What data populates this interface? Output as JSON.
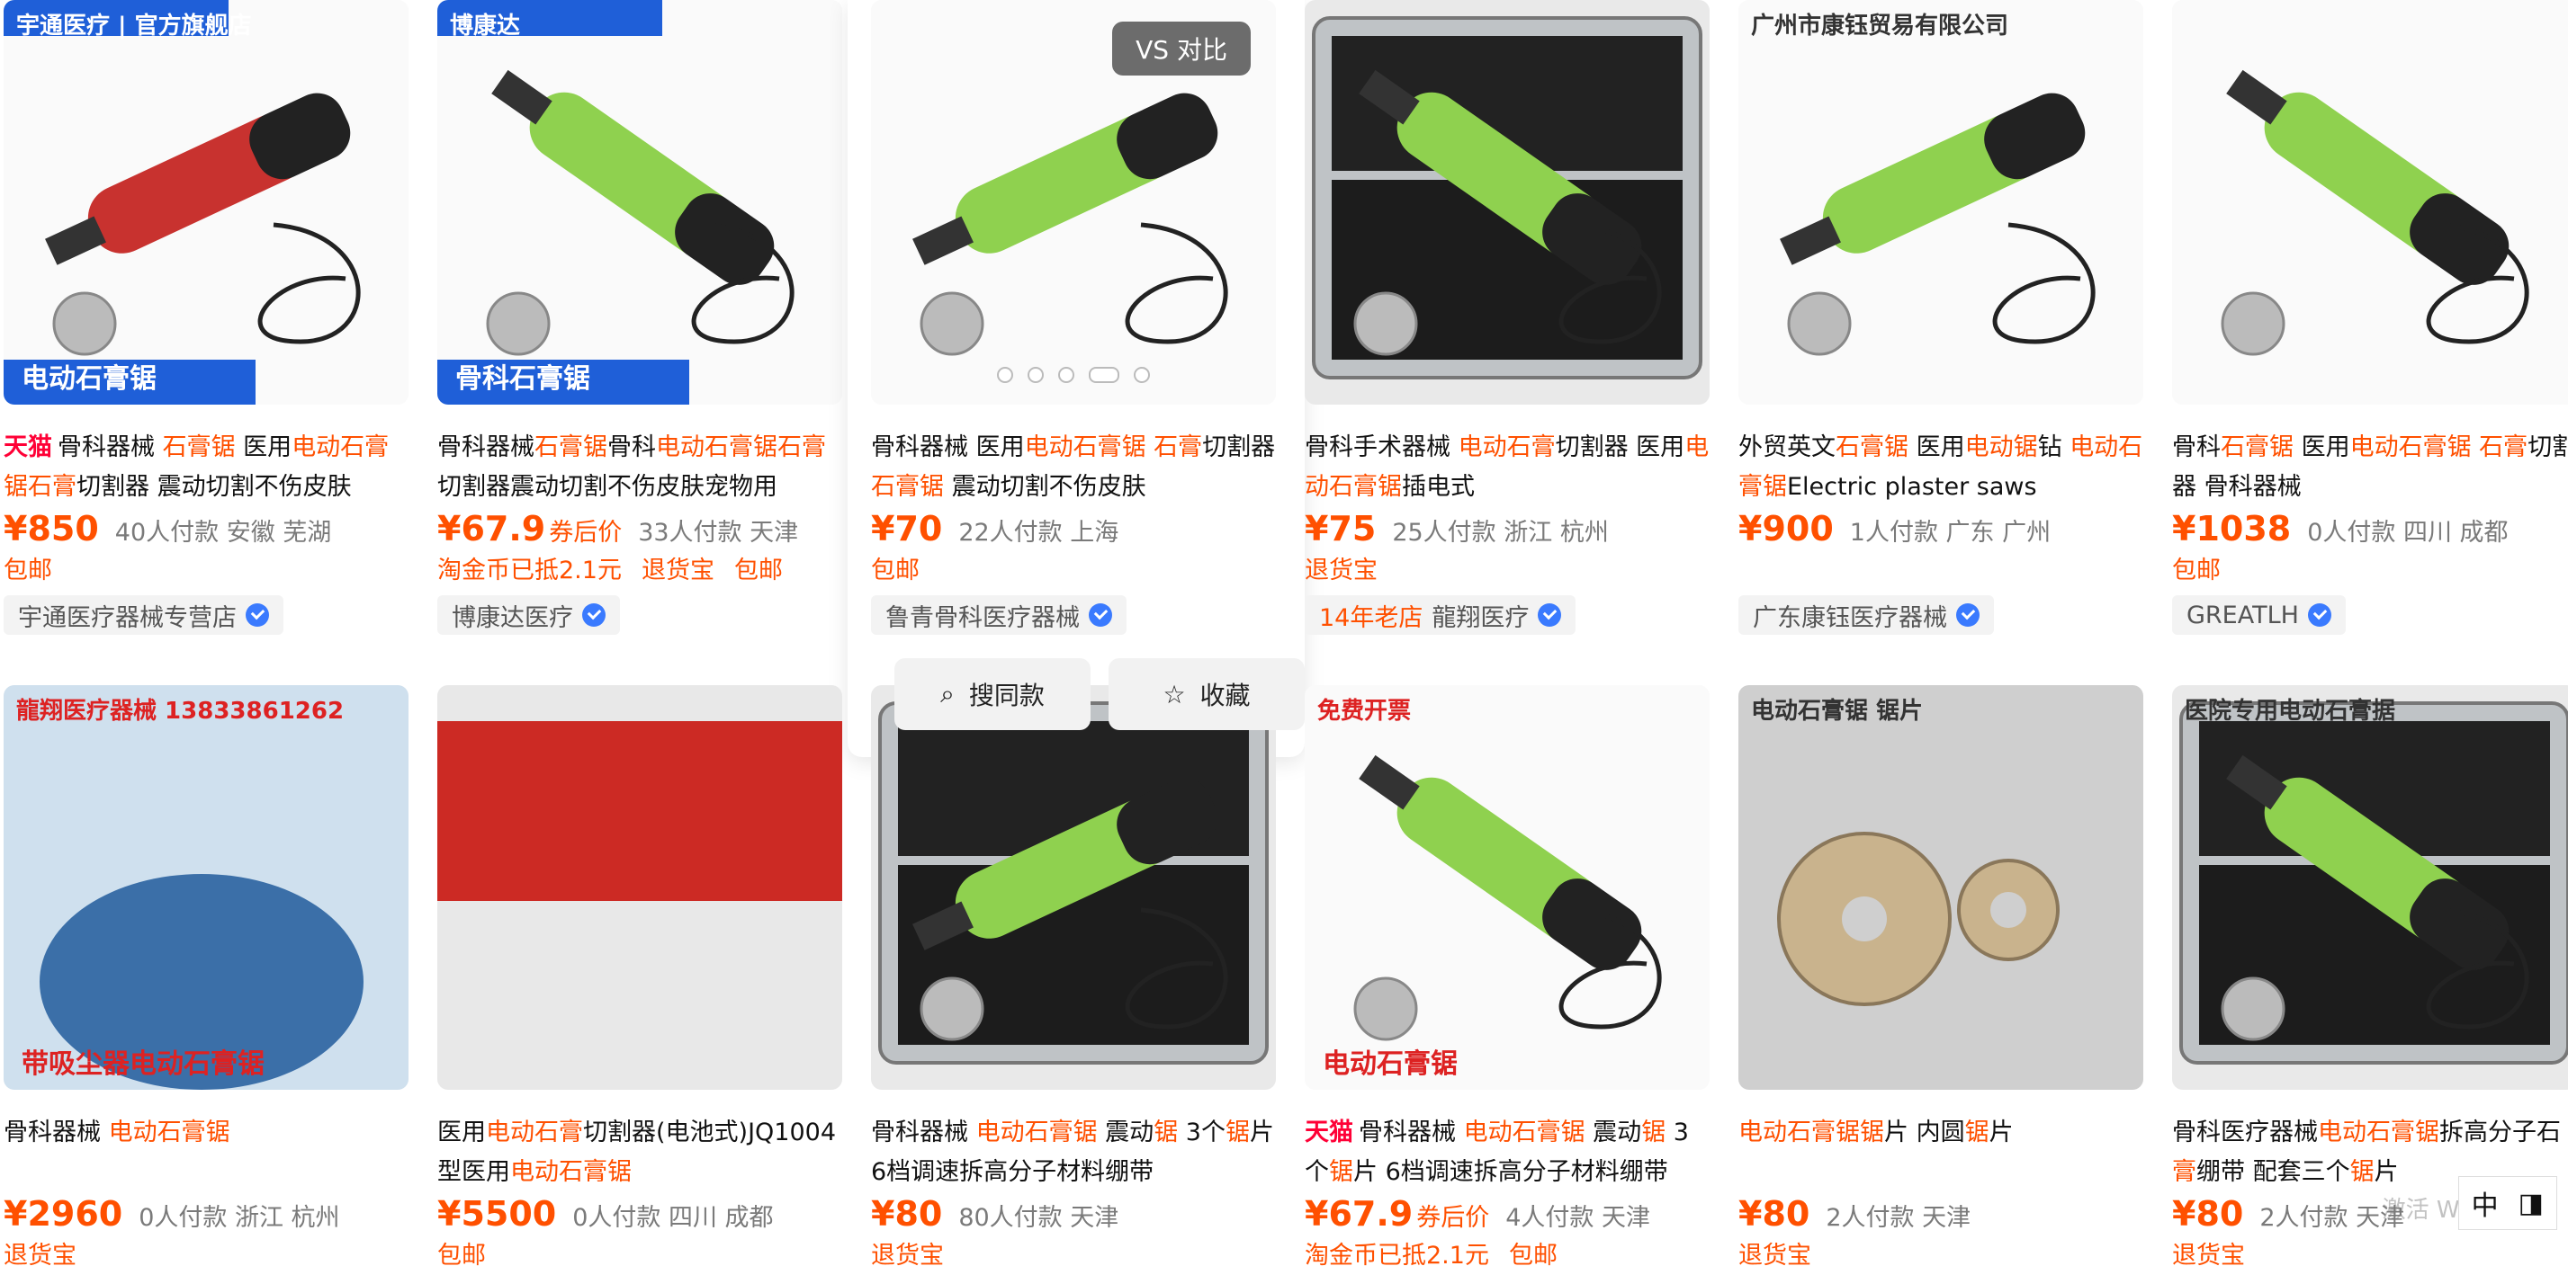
{
  "compare_button": {
    "label": "VS  对比"
  },
  "hover_actions": {
    "same_label": "搜同款",
    "fav_label": "收藏"
  },
  "ime": {
    "mode": "中"
  },
  "watermark": "激活 Windows",
  "cards": [
    {
      "img_text": "宇通医疗 | 官方旗舰店",
      "img_bottom": "电动石膏锯",
      "title_parts": [
        {
          "t": "天猫",
          "c": "tmall"
        },
        {
          "t": "骨科器械 "
        },
        {
          "t": "石膏锯",
          "c": "hl"
        },
        {
          "t": " 医用"
        },
        {
          "t": "电动石膏锯石膏",
          "c": "hl"
        },
        {
          "t": "切割器 震动切割不伤皮肤"
        }
      ],
      "price": "¥850",
      "coupon": "",
      "meta": "40人付款  安徽 芜湖",
      "tags": [
        "包邮"
      ],
      "shop": "宇通医疗器械专营店",
      "old": ""
    },
    {
      "img_text": "博康达",
      "img_bottom": "骨科石膏锯",
      "title_parts": [
        {
          "t": "骨科器械"
        },
        {
          "t": "石膏锯",
          "c": "hl"
        },
        {
          "t": "骨科"
        },
        {
          "t": "电动石膏锯石膏",
          "c": "hl"
        },
        {
          "t": "切割器震动切割不伤皮肤宠物用"
        }
      ],
      "price": "¥67.9",
      "coupon": "券后价",
      "meta": "33人付款  天津",
      "tags": [
        "淘金币已抵2.1元",
        "退货宝",
        "包邮"
      ],
      "shop": "博康达医疗",
      "old": ""
    },
    {
      "img_text": "",
      "img_bottom": "",
      "title_parts": [
        {
          "t": "骨科器械 医用"
        },
        {
          "t": "电动石膏锯 石膏",
          "c": "hl"
        },
        {
          "t": "切割器 "
        },
        {
          "t": "石膏锯",
          "c": "hl"
        },
        {
          "t": " 震动切割不伤皮肤"
        }
      ],
      "price": "¥70",
      "coupon": "",
      "meta": "22人付款  上海",
      "tags": [
        "包邮"
      ],
      "shop": "鲁青骨科医疗器械",
      "old": ""
    },
    {
      "img_text": "",
      "img_bottom": "",
      "title_parts": [
        {
          "t": "骨科手术器械 "
        },
        {
          "t": "电动石膏",
          "c": "hl"
        },
        {
          "t": "切割器 医用"
        },
        {
          "t": "电动石膏锯",
          "c": "hl"
        },
        {
          "t": "插电式"
        }
      ],
      "price": "¥75",
      "coupon": "",
      "meta": "25人付款  浙江 杭州",
      "tags": [
        "退货宝"
      ],
      "shop": "龍翔医疗",
      "old": "14年老店"
    },
    {
      "img_text": "广州市康钰贸易有限公司",
      "img_bottom": "",
      "title_parts": [
        {
          "t": "外贸英文"
        },
        {
          "t": "石膏锯",
          "c": "hl"
        },
        {
          "t": " 医用"
        },
        {
          "t": "电动锯",
          "c": "hl"
        },
        {
          "t": "钻 "
        },
        {
          "t": "电动石膏锯",
          "c": "hl"
        },
        {
          "t": "Electric plaster saws"
        }
      ],
      "price": "¥900",
      "coupon": "",
      "meta": "1人付款  广东 广州",
      "tags": [],
      "shop": "广东康钰医疗器械",
      "old": ""
    },
    {
      "img_text": "",
      "img_bottom": "",
      "title_parts": [
        {
          "t": "骨科"
        },
        {
          "t": "石膏锯",
          "c": "hl"
        },
        {
          "t": " 医用"
        },
        {
          "t": "电动石膏锯 石膏",
          "c": "hl"
        },
        {
          "t": "切割器 骨科器械"
        }
      ],
      "price": "¥1038",
      "coupon": "",
      "meta": "0人付款  四川 成都",
      "tags": [
        "包邮"
      ],
      "shop": "GREATLH",
      "old": ""
    },
    {
      "img_text": "龍翔医疗器械 13833861262",
      "img_bottom": "带吸尘器电动石膏锯",
      "title_parts": [
        {
          "t": "骨科器械 "
        },
        {
          "t": "电动石膏锯",
          "c": "hl"
        }
      ],
      "price": "¥2960",
      "coupon": "",
      "meta": "0人付款  浙江 杭州",
      "tags": [
        "退货宝"
      ],
      "shop": "",
      "old": ""
    },
    {
      "img_text": "",
      "img_bottom": "",
      "title_parts": [
        {
          "t": "医用"
        },
        {
          "t": "电动石膏",
          "c": "hl"
        },
        {
          "t": "切割器(电池式)JQ1004型医用"
        },
        {
          "t": "电动石膏锯",
          "c": "hl"
        }
      ],
      "price": "¥5500",
      "coupon": "",
      "meta": "0人付款  四川 成都",
      "tags": [
        "包邮"
      ],
      "shop": "",
      "old": ""
    },
    {
      "img_text": "",
      "img_bottom": "",
      "title_parts": [
        {
          "t": "骨科器械 "
        },
        {
          "t": "电动石膏锯",
          "c": "hl"
        },
        {
          "t": " 震动"
        },
        {
          "t": "锯",
          "c": "hl"
        },
        {
          "t": " 3个"
        },
        {
          "t": "锯",
          "c": "hl"
        },
        {
          "t": "片 6档调速拆高分子材料绷带"
        }
      ],
      "price": "¥80",
      "coupon": "",
      "meta": "80人付款  天津",
      "tags": [
        "退货宝"
      ],
      "shop": "",
      "old": ""
    },
    {
      "img_text": "免费开票",
      "img_bottom": "电动石膏锯",
      "title_parts": [
        {
          "t": "天猫",
          "c": "tmall"
        },
        {
          "t": "骨科器械 "
        },
        {
          "t": "电动石膏锯",
          "c": "hl"
        },
        {
          "t": " 震动"
        },
        {
          "t": "锯",
          "c": "hl"
        },
        {
          "t": " 3个"
        },
        {
          "t": "锯",
          "c": "hl"
        },
        {
          "t": "片 6档调速拆高分子材料绷带"
        }
      ],
      "price": "¥67.9",
      "coupon": "券后价",
      "meta": "4人付款  天津",
      "tags": [
        "淘金币已抵2.1元",
        "包邮"
      ],
      "shop": "",
      "old": ""
    },
    {
      "img_text": "电动石膏锯 锯片",
      "img_bottom": "",
      "title_parts": [
        {
          "t": "电动石膏锯锯",
          "c": "hl"
        },
        {
          "t": "片 内圆"
        },
        {
          "t": "锯",
          "c": "hl"
        },
        {
          "t": "片"
        }
      ],
      "price": "¥80",
      "coupon": "",
      "meta": "2人付款  天津",
      "tags": [
        "退货宝"
      ],
      "shop": "",
      "old": ""
    },
    {
      "img_text": "医院专用电动石膏据",
      "img_bottom": "",
      "title_parts": [
        {
          "t": "骨科医疗器械"
        },
        {
          "t": "电动石膏锯",
          "c": "hl"
        },
        {
          "t": "拆高分子石"
        },
        {
          "t": "膏",
          "c": "hl"
        },
        {
          "t": "绷带 配套三个"
        },
        {
          "t": "锯",
          "c": "hl"
        },
        {
          "t": "片"
        }
      ],
      "price": "¥80",
      "coupon": "",
      "meta": "2人付款  天津",
      "tags": [
        "退货宝"
      ],
      "shop": "",
      "old": ""
    }
  ],
  "colors": {
    "accent": "#ff5000",
    "tmall": "#ff0036",
    "tool_green": "#8fd14f",
    "tool_red": "#c8322f",
    "blue_banner": "#1f5fd8"
  }
}
